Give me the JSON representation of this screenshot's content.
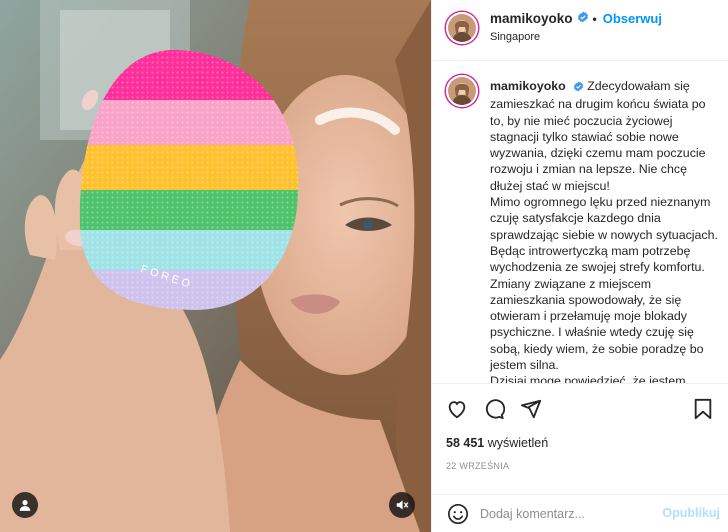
{
  "post": {
    "username": "mamikoyoko",
    "verified": true,
    "separator": "•",
    "follow_label": "Obserwuj",
    "location": "Singapore",
    "caption": "Zdecydowałam się zamieszkać na drugim końcu świata po to, by nie mieć poczucia życiowej stagnacji tylko stawiać sobie nowe wyzwania, dzięki czemu mam poczucie rozwoju i zmian na lepsze. Nie chcę dłużej stać w miejscu!\nMimo ogromnego lęku przed nieznanym czuję satysfakcje kazdego dnia sprawdzając siebie w nowych sytuacjach. Będąc introwertyczką mam potrzebę wychodzenia ze swojej strefy komfortu. Zmiany związane z miejscem zamieszkania spowodowały, że się otwieram i przełamuję moje blokady psychiczne. I właśnie wtedy czuję się sobą, kiedy wiem, że sobie poradzę bo jestem silna.\nDzisiaj mogę powiedzieć, że jestem",
    "views_count": "58 451",
    "views_label": "wyświetleń",
    "date": "22 WRZEŚNIA",
    "brand_on_media": "FOREO"
  },
  "comment": {
    "placeholder": "Dodaj komentarz...",
    "publish_label": "Opublikuj"
  },
  "icons": {
    "tag": "user-tag-icon",
    "mute": "speaker-muted-icon",
    "like": "heart-icon",
    "comment": "comment-bubble-icon",
    "share": "paper-plane-icon",
    "save": "bookmark-icon",
    "emoji": "smiley-icon",
    "verified": "verified-badge-icon"
  },
  "colors": {
    "accent": "#0095f6",
    "publish_disabled": "#b2dffc",
    "muted_text": "#8e8e8e",
    "border": "#efefef"
  }
}
